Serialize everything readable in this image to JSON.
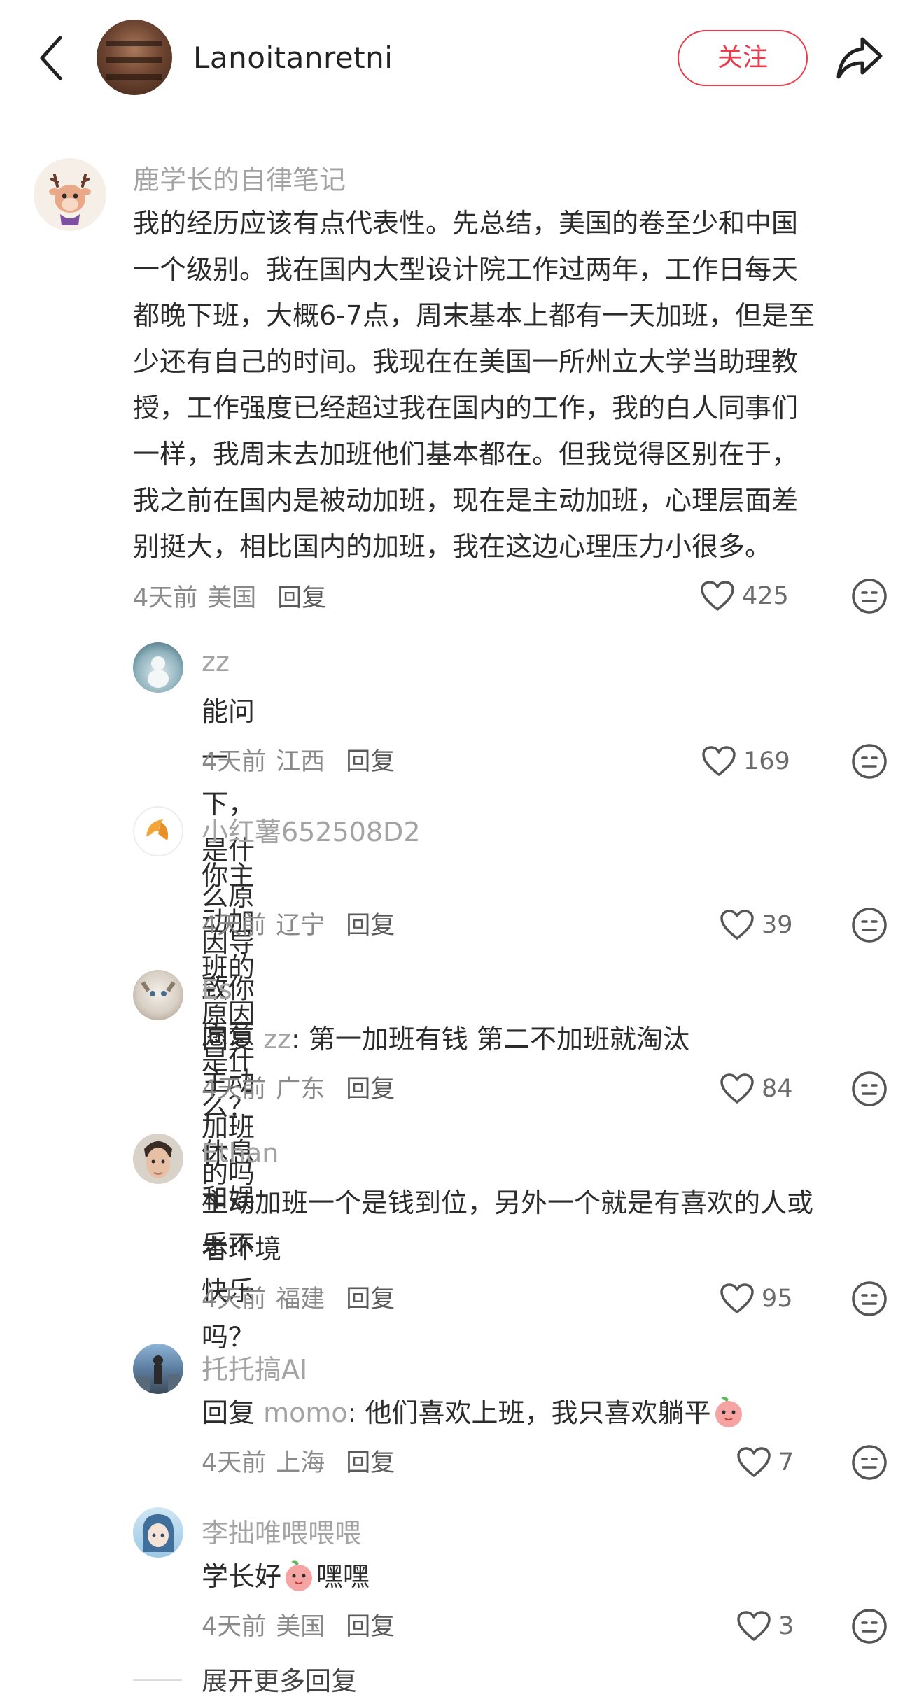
{
  "header": {
    "username": "Lanoitanretni",
    "follow_label": "关注"
  },
  "main_comment": {
    "author": "鹿学长的自律笔记",
    "lines": [
      "我的经历应该有点代表性。先总结，美国的卷至少和中国",
      "一个级别。我在国内大型设计院工作过两年，工作日每天",
      "都晚下班，大概6-7点，周末基本上都有一天加班，但是至",
      "少还有自己的时间。我现在在美国一所州立大学当助理教",
      "授，工作强度已经超过我在国内的工作，我的白人同事们",
      "一样，我周末去加班他们基本都在。但我觉得区别在于，",
      "我之前在国内是被动加班，现在是主动加班，心理层面差",
      "别挺大，相比国内的加班，我在这边心理压力小很多。"
    ],
    "time": "4天前",
    "location": "美国",
    "reply_label": "回复",
    "likes": "425"
  },
  "replies": [
    {
      "author": "zz",
      "line1": "能问一下，是什么原因导致你愿意主动加班的吗",
      "time": "4天前",
      "location": "江西",
      "reply_label": "回复",
      "likes": "169"
    },
    {
      "author": "小红薯652508D2",
      "line1": "你主动加班的原因是什么？休息和娱乐不快乐吗？",
      "time": "4天前",
      "location": "辽宁",
      "reply_label": "回复",
      "likes": "39"
    },
    {
      "author": "Es",
      "prefix": "回复 ",
      "ref": "zz",
      "line1": ": 第一加班有钱 第二不加班就淘汰",
      "time": "4天前",
      "location": "广东",
      "reply_label": "回复",
      "likes": "84"
    },
    {
      "author": "Ethan",
      "line1": "主动加班一个是钱到位，另外一个就是有喜欢的人或",
      "line2": "者环境",
      "time": "4天前",
      "location": "福建",
      "reply_label": "回复",
      "likes": "95"
    },
    {
      "author": "托托搞AI",
      "prefix": "回复 ",
      "ref": "momo",
      "line1": ": 他们喜欢上班，我只喜欢躺平",
      "emoji": "peach-emoji",
      "time": "4天前",
      "location": "上海",
      "reply_label": "回复",
      "likes": "7"
    },
    {
      "author": "李拙唯喂喂喂",
      "line1": "学长好",
      "emoji": "peach-emoji",
      "line1b": "嘿嘿",
      "time": "4天前",
      "location": "美国",
      "reply_label": "回复",
      "likes": "3"
    }
  ],
  "expand_more": "展开更多回复",
  "colors": {
    "accent": "#ec3b4a",
    "name_gray": "#a3a3a3",
    "meta_gray": "#8a8a8a"
  },
  "icons": [
    "back-arrow-icon",
    "share-icon",
    "heart-icon",
    "emoji-face-icon",
    "peach-emoji"
  ]
}
